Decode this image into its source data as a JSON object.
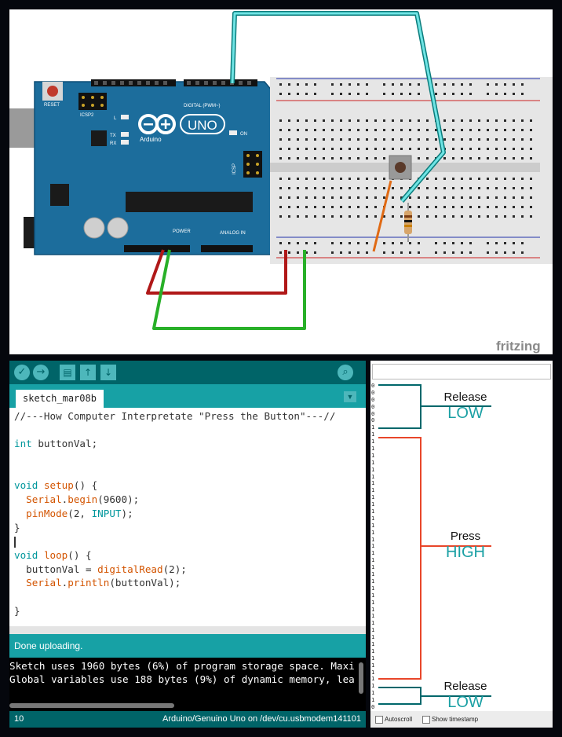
{
  "circuit": {
    "board_labels": {
      "reset": "RESET",
      "icsp2": "ICSP2",
      "logo_text": "Arduino",
      "uno": "UNO",
      "led_l": "L",
      "led_tx": "TX",
      "led_rx": "RX",
      "led_on": "ON",
      "icsp": "ICSP",
      "digital": "DIGITAL (PWM~)",
      "power": "POWER",
      "analog": "ANALOG IN"
    },
    "watermark": "fritzing"
  },
  "ide": {
    "toolbar_icons": [
      "verify-icon",
      "upload-icon",
      "new-icon",
      "open-icon",
      "save-icon",
      "serial-monitor-icon"
    ],
    "tab_label": "sketch_mar08b",
    "code_lines": [
      "//---How Computer Interpretate \"Press the Button\"---//",
      "",
      "int buttonVal;",
      "",
      "",
      "void setup() {",
      "  Serial.begin(9600);",
      "  pinMode(2, INPUT);",
      "}",
      "",
      "void loop() {",
      "  buttonVal = digitalRead(2);",
      "  Serial.println(buttonVal);",
      "",
      "}"
    ],
    "status_message": "Done uploading.",
    "console_lines": [
      "Sketch uses 1960 bytes (6%) of program storage space. Maxi",
      "Global variables use 188 bytes (9%) of dynamic memory, lea"
    ],
    "line_number": "10",
    "board_port": "Arduino/Genuino Uno on /dev/cu.usbmodem141101",
    "colors": {
      "teal_dark": "#006468",
      "teal": "#17a1a5",
      "keyword": "#00979c",
      "function": "#d35400"
    }
  },
  "serial_monitor": {
    "values": [
      "0",
      "0",
      "0",
      "0",
      "0",
      "0",
      "1",
      "1",
      "1",
      "1",
      "1",
      "1",
      "1",
      "1",
      "1",
      "1",
      "1",
      "1",
      "1",
      "1",
      "1",
      "1",
      "1",
      "1",
      "1",
      "1",
      "1",
      "1",
      "1",
      "1",
      "1",
      "1",
      "1",
      "1",
      "1",
      "1",
      "1",
      "1",
      "1",
      "1",
      "1",
      "1",
      "1",
      "1",
      "1",
      "1",
      "0",
      "0",
      "0"
    ],
    "autoscroll_label": "Autoscroll",
    "timestamp_label": "Show timestamp"
  },
  "annotations": [
    {
      "action": "Release",
      "state": "LOW"
    },
    {
      "action": "Press",
      "state": "HIGH"
    },
    {
      "action": "Release",
      "state": "LOW"
    }
  ],
  "annotation_colors": {
    "low": "#00676b",
    "high": "#e8462a",
    "state_text": "#1aa0a4"
  }
}
